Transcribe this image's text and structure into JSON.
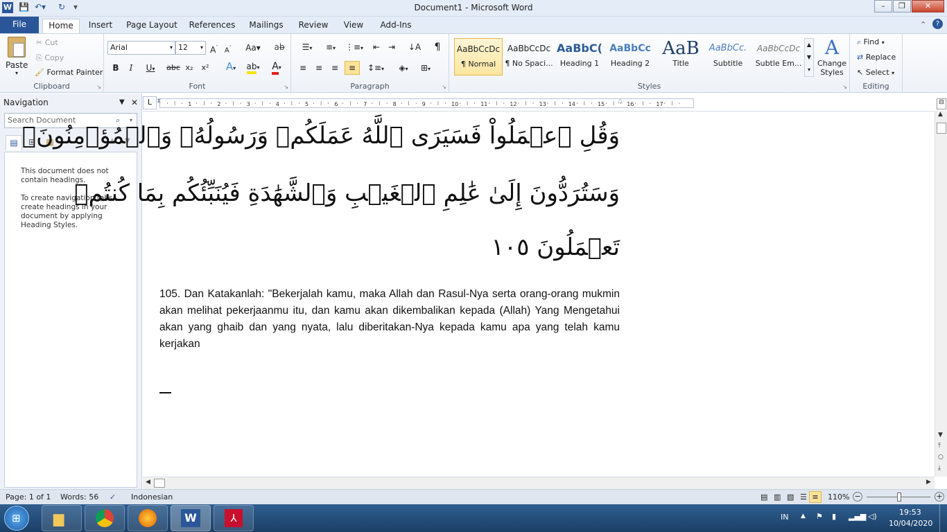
{
  "window": {
    "title": "Document1  -  Microsoft Word",
    "min_glyph": "–",
    "max_glyph": "❐",
    "close_glyph": "✕"
  },
  "tabs": [
    "File",
    "Home",
    "Insert",
    "Page Layout",
    "References",
    "Mailings",
    "Review",
    "View",
    "Add-Ins"
  ],
  "ribbon": {
    "clipboard": {
      "label": "Clipboard",
      "paste": "Paste",
      "cut": "Cut",
      "copy": "Copy",
      "format_painter": "Format Painter"
    },
    "font": {
      "label": "Font",
      "family": "Arial",
      "size": "12"
    },
    "paragraph": {
      "label": "Paragraph"
    },
    "styles": {
      "label": "Styles",
      "items": [
        {
          "sample": "AaBbCcDc",
          "name": "¶ Normal"
        },
        {
          "sample": "AaBbCcDc",
          "name": "¶ No Spaci..."
        },
        {
          "sample": "AaBbC(",
          "name": "Heading 1"
        },
        {
          "sample": "AaBbCc",
          "name": "Heading 2"
        },
        {
          "sample": "AaB",
          "name": "Title"
        },
        {
          "sample": "AaBbCc.",
          "name": "Subtitle"
        },
        {
          "sample": "AaBbCcDc",
          "name": "Subtle Em..."
        }
      ],
      "change_styles": "Change Styles"
    },
    "editing": {
      "label": "Editing",
      "find": "Find",
      "replace": "Replace",
      "select": "Select"
    }
  },
  "navigation": {
    "title": "Navigation",
    "search_placeholder": "Search Document",
    "msg1": "This document does not contain headings.",
    "msg2": "To create navigation tabs, create headings in your document by applying Heading Styles."
  },
  "ruler": {
    "corner": "L"
  },
  "document": {
    "arabic_lines": [
      "وَقُلِ ٱعۡمَلُواْ فَسَيَرَى ٱللَّهُ عَمَلَكُمۡ وَرَسُولُهُۥ وَٱلۡمُؤۡمِنُونَۖ",
      "وَسَتُرَدُّونَ إِلَىٰ عَٰلِمِ ٱلۡغَيۡبِ وَٱلشَّهَٰدَةِ فَيُنَبِّئُكُم بِمَا كُنتُمۡ",
      "تَعۡمَلُونَ ١٠٥"
    ],
    "translation": "105. Dan Katakanlah: \"Bekerjalah kamu, maka Allah dan Rasul-Nya serta orang-orang mukmin akan melihat pekerjaanmu itu, dan kamu akan dikembalikan kepada (Allah) Yang Mengetahui akan yang ghaib dan yang nyata, lalu diberitakan-Nya kepada kamu apa yang telah kamu kerjakan"
  },
  "status": {
    "page": "Page: 1 of 1",
    "words": "Words: 56",
    "language": "Indonesian",
    "zoom": "110%"
  },
  "taskbar": {
    "ime": "IN",
    "time": "19:53",
    "date": "10/04/2020"
  },
  "colors": {
    "file_tab": "#2a5699",
    "taskbar": "#1b3f66",
    "accent": "#2b579a"
  }
}
